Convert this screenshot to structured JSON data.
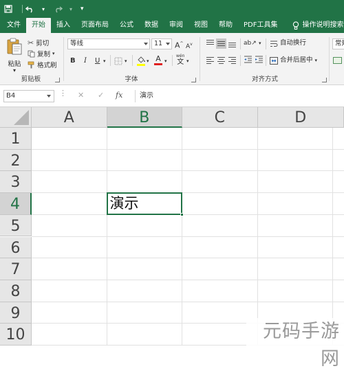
{
  "ribbon_tabs": [
    "文件",
    "开始",
    "插入",
    "页面布局",
    "公式",
    "数据",
    "审阅",
    "视图",
    "帮助",
    "PDF工具集"
  ],
  "active_tab": "开始",
  "tell_me": "操作说明搜索",
  "clipboard": {
    "paste": "粘贴",
    "cut": "剪切",
    "copy": "复制",
    "format_painter": "格式刷",
    "label": "剪贴板"
  },
  "font": {
    "name": "等线",
    "size": "11",
    "grow": "A",
    "shrink": "A",
    "bold": "B",
    "italic": "I",
    "underline": "U",
    "label": "字体",
    "phonetic": "wén"
  },
  "alignment": {
    "wrap_text": "自动换行",
    "merge_center": "合并后居中",
    "label": "对齐方式"
  },
  "number": {
    "format": "常规"
  },
  "formula_bar": {
    "name_box": "B4",
    "cancel": "✕",
    "enter": "✓",
    "fx": "fx",
    "value": "演示"
  },
  "columns": [
    "A",
    "B",
    "C",
    "D"
  ],
  "rows": [
    "1",
    "2",
    "3",
    "4",
    "5",
    "6",
    "7",
    "8",
    "9",
    "10"
  ],
  "selected": {
    "column": "B",
    "row": "4"
  },
  "cells": {
    "B4": "演示"
  },
  "watermark": "元码手游网",
  "colors": {
    "accent": "#217346",
    "header_bg": "#e6e6e6",
    "gridline": "#e1e1e1"
  }
}
